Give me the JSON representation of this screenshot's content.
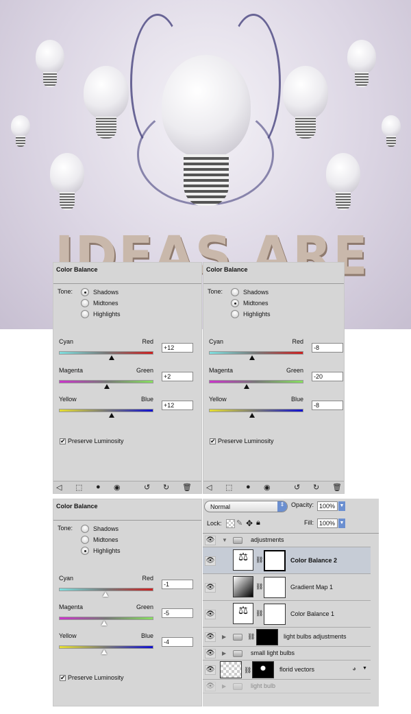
{
  "artwork": {
    "headline": "IDEAS ARE"
  },
  "color_balance_panels": [
    {
      "title": "Color Balance",
      "tone_label": "Tone:",
      "tones": [
        "Shadows",
        "Midtones",
        "Highlights"
      ],
      "selected_tone": "Shadows",
      "sliders": [
        {
          "left": "Cyan",
          "right": "Red",
          "value": "+12",
          "num": 12,
          "colors": [
            "#7fe0e0",
            "#cc2020"
          ]
        },
        {
          "left": "Magenta",
          "right": "Green",
          "value": "+2",
          "num": 2,
          "colors": [
            "#cc33cc",
            "#88e060"
          ]
        },
        {
          "left": "Yellow",
          "right": "Blue",
          "value": "+12",
          "num": 12,
          "colors": [
            "#e8e030",
            "#1010d0"
          ]
        }
      ],
      "preserve_luminosity": "Preserve Luminosity",
      "preserve_checked": true
    },
    {
      "title": "Color Balance",
      "tone_label": "Tone:",
      "tones": [
        "Shadows",
        "Midtones",
        "Highlights"
      ],
      "selected_tone": "Midtones",
      "sliders": [
        {
          "left": "Cyan",
          "right": "Red",
          "value": "-8",
          "num": -8,
          "colors": [
            "#7fe0e0",
            "#cc2020"
          ]
        },
        {
          "left": "Magenta",
          "right": "Green",
          "value": "-20",
          "num": -20,
          "colors": [
            "#cc33cc",
            "#88e060"
          ]
        },
        {
          "left": "Yellow",
          "right": "Blue",
          "value": "-8",
          "num": -8,
          "colors": [
            "#e8e030",
            "#1010d0"
          ]
        }
      ],
      "preserve_luminosity": "Preserve Luminosity",
      "preserve_checked": true
    },
    {
      "title": "Color Balance",
      "tone_label": "Tone:",
      "tones": [
        "Shadows",
        "Midtones",
        "Highlights"
      ],
      "selected_tone": "Highlights",
      "sliders": [
        {
          "left": "Cyan",
          "right": "Red",
          "value": "-1",
          "num": -1,
          "colors": [
            "#7fe0e0",
            "#cc2020"
          ]
        },
        {
          "left": "Magenta",
          "right": "Green",
          "value": "-5",
          "num": -5,
          "colors": [
            "#cc33cc",
            "#88e060"
          ]
        },
        {
          "left": "Yellow",
          "right": "Blue",
          "value": "-4",
          "num": -4,
          "colors": [
            "#e8e030",
            "#1010d0"
          ]
        }
      ],
      "preserve_luminosity": "Preserve Luminosity",
      "preserve_checked": true
    }
  ],
  "footer_icons": [
    "back-arrow-icon",
    "expand-view-icon",
    "clip-layer-icon",
    "visibility-eye-icon",
    "view-previous-icon",
    "reset-icon",
    "trash-icon"
  ],
  "layers": {
    "blend_mode": "Normal",
    "opacity_label": "Opacity:",
    "opacity": "100%",
    "lock_label": "Lock:",
    "fill_label": "Fill:",
    "fill": "100%",
    "items": [
      {
        "name": "adjustments",
        "type": "group",
        "expanded": true
      },
      {
        "name": "Color Balance 2",
        "type": "color-balance",
        "selected": true
      },
      {
        "name": "Gradient Map 1",
        "type": "gradient-map"
      },
      {
        "name": "Color Balance 1",
        "type": "color-balance"
      },
      {
        "name": "light bulbs adjustments",
        "type": "group-masked"
      },
      {
        "name": "small light bulbs",
        "type": "group"
      },
      {
        "name": "florid vectors",
        "type": "smart-object"
      },
      {
        "name": "light bulb",
        "type": "group",
        "faded": true
      }
    ]
  }
}
